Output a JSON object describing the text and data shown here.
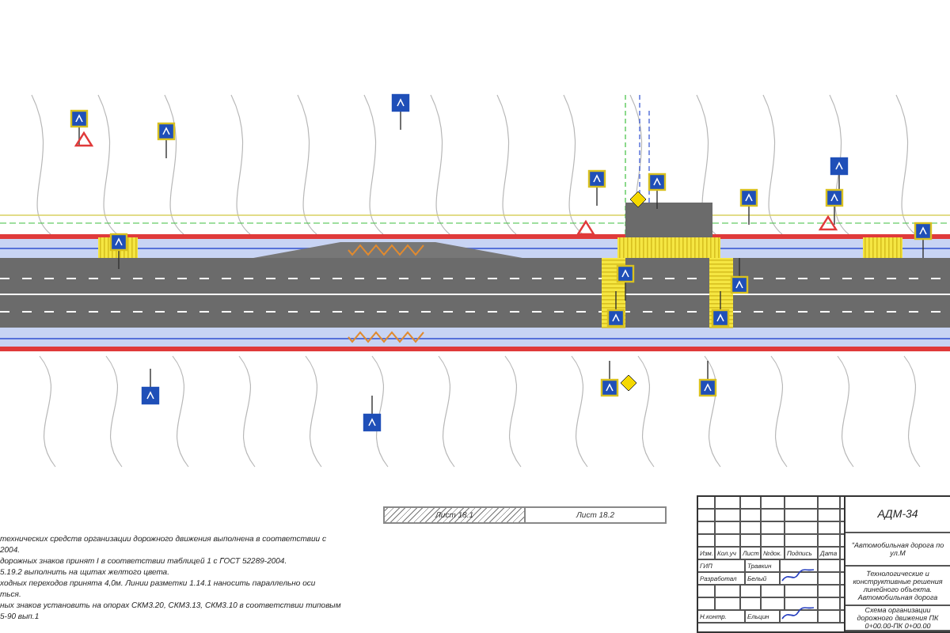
{
  "notes": [
    "технических средств организации дорожного движения выполнена в соответствии с",
    "2004.",
    "дорожных знаков принят I в соответствии таблицей 1 с ГОСТ 52289-2004.",
    "5.19.2 выполнить на щитах желтого цвета.",
    "ходных переходов принята 4,0м. Линии разметки 1.14.1 наносить параллельно оси",
    "ться.",
    "ных знаков установить на опорах СКМ3.20, СКМ3.13, СКМ3.10 в соответствии типовым",
    "5-90 вып.1"
  ],
  "sheet_key": [
    {
      "label": "Лист 18.1",
      "hatched": true
    },
    {
      "label": "Лист 18.2",
      "hatched": false
    }
  ],
  "title_block": {
    "code": "АДМ-34",
    "object": "\"Автомобильная дорога по ул.М",
    "header_cells": [
      "Изм.",
      "Кол.уч",
      "Лист",
      "№док.",
      "Подпись",
      "Дата"
    ],
    "staff": [
      {
        "role": "ГИП",
        "name": "Травкин",
        "signed": false
      },
      {
        "role": "Разработал",
        "name": "Белый",
        "signed": true
      },
      {
        "role": "Н.контр.",
        "name": "Ельцин",
        "signed": true
      }
    ],
    "section": "Технологические и конструктивные решения линейного объекта. Автомобильная дорога",
    "sheet_title": "Схема организации дорожного движения ПК 0+00.00-ПК 0+00.00"
  }
}
